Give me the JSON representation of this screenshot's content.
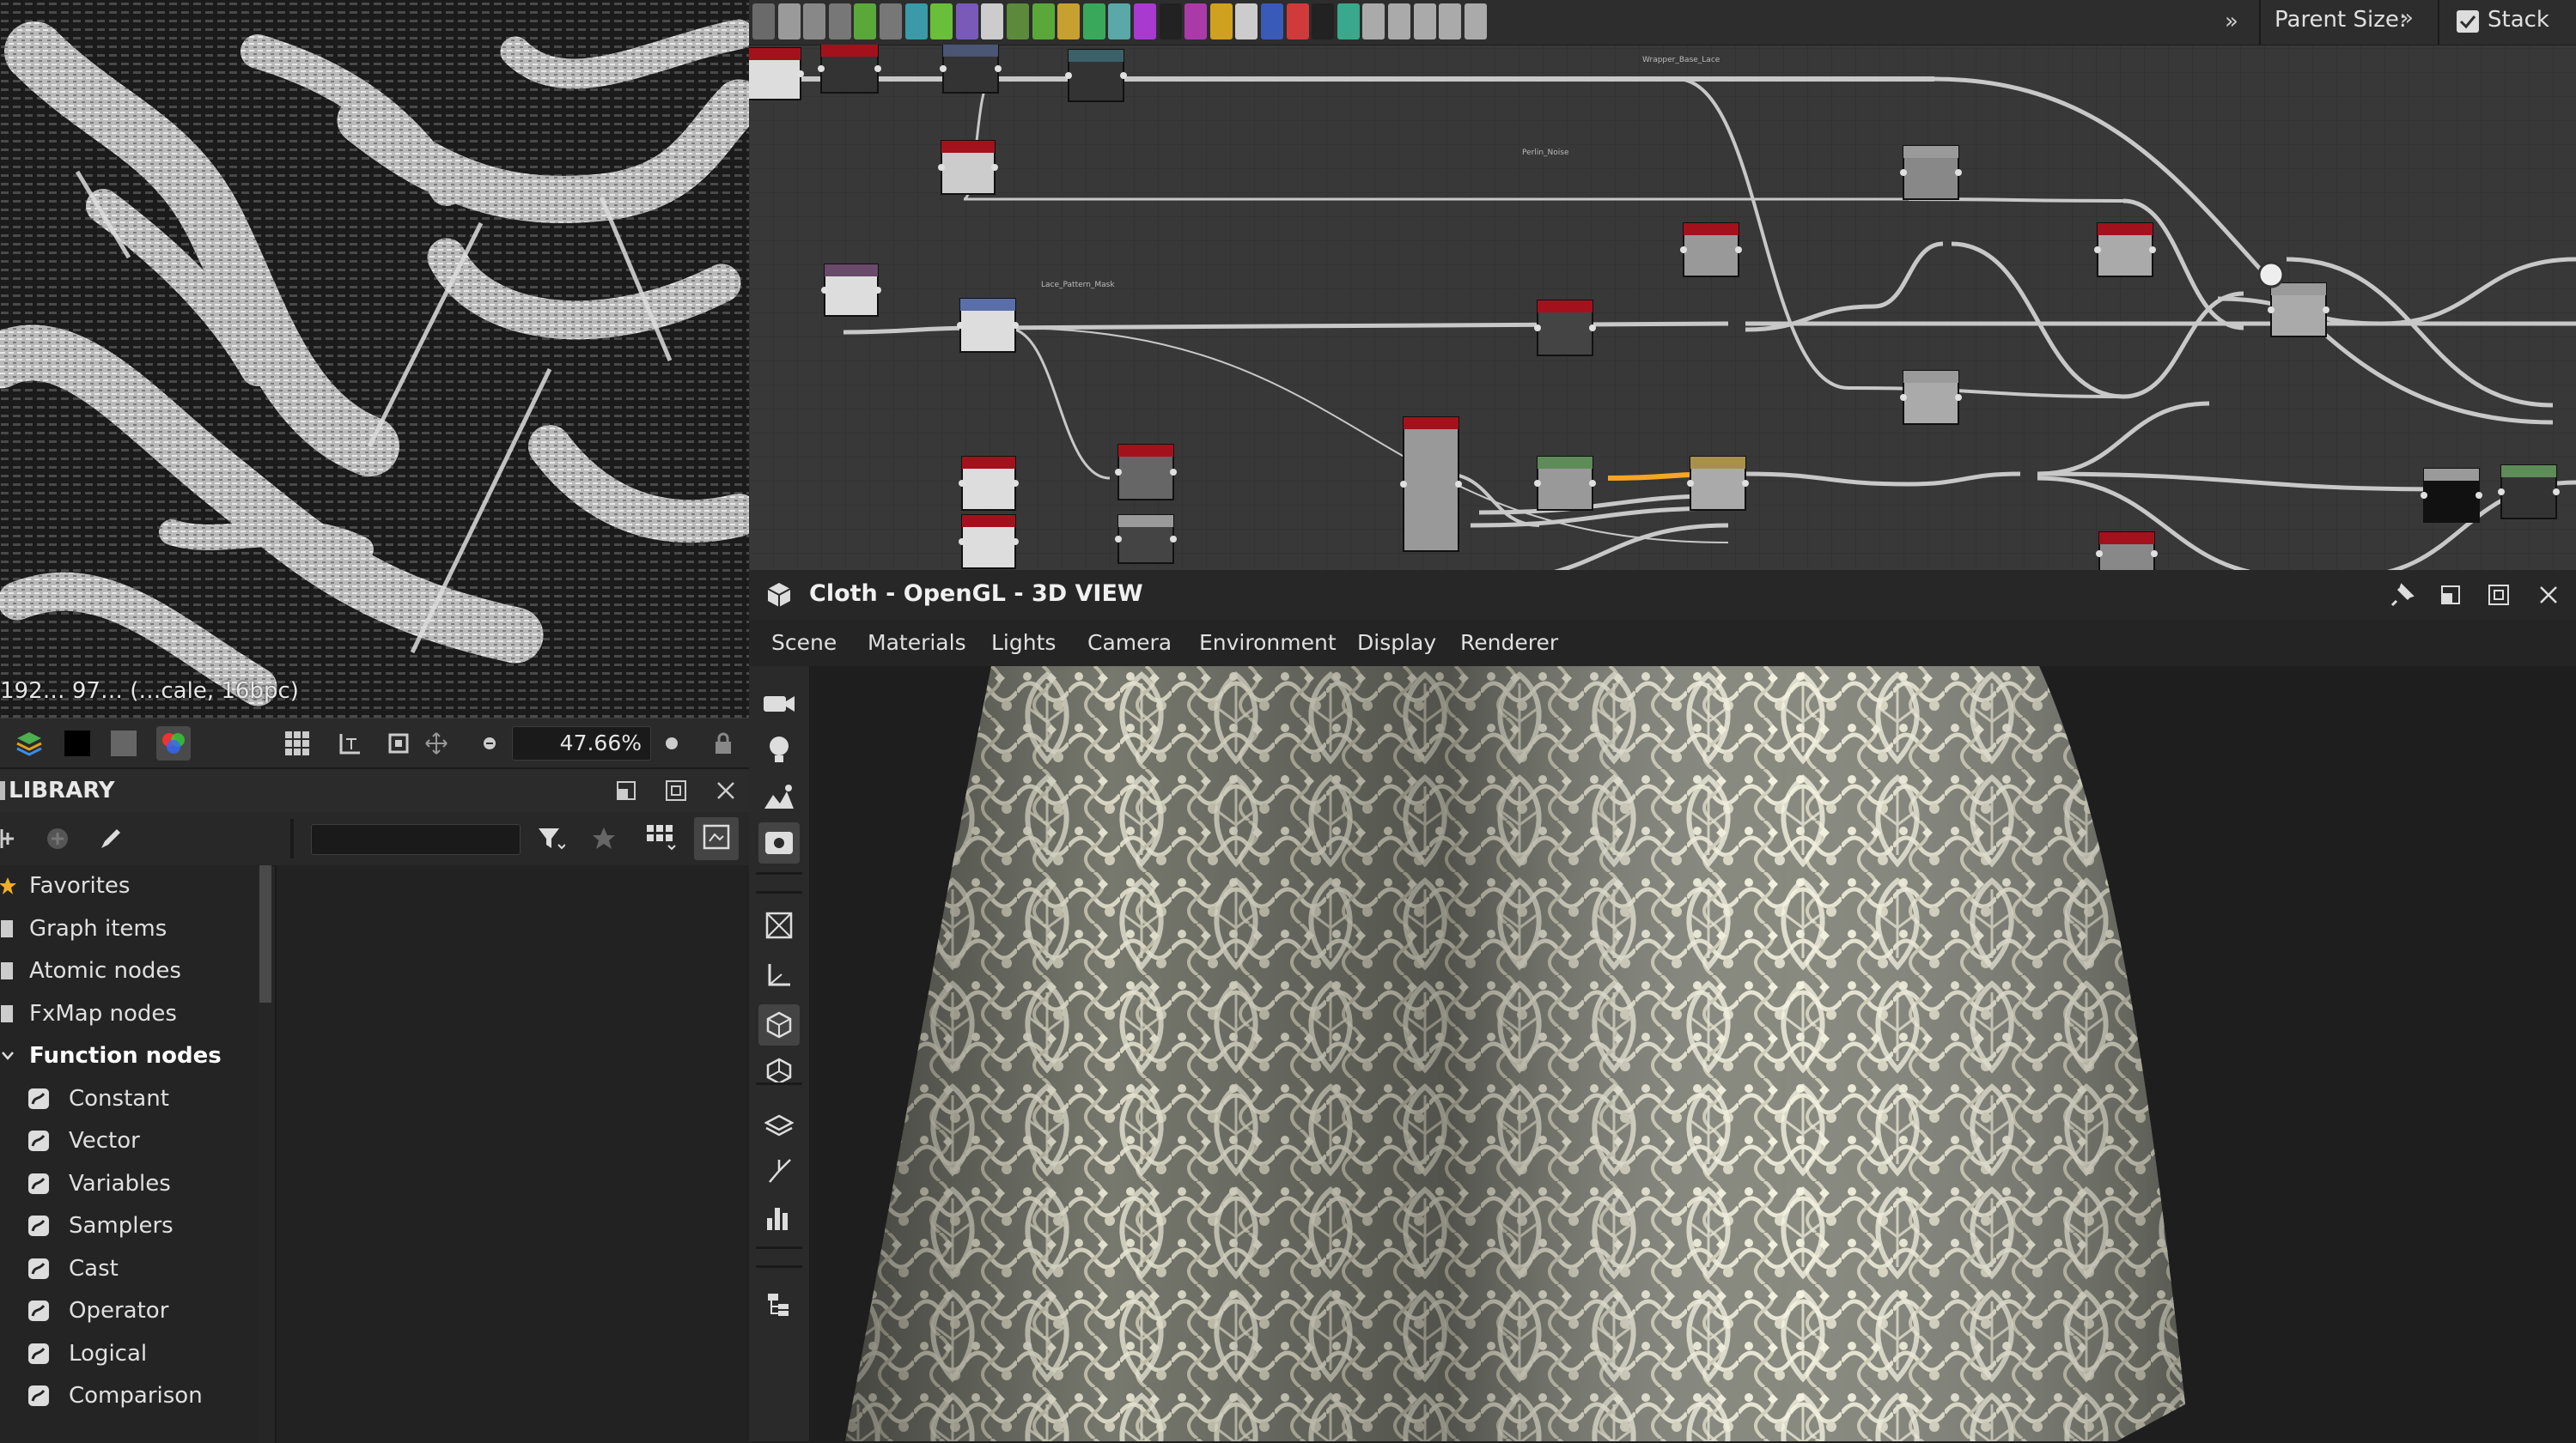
{
  "view2d": {
    "status": "192… 97… (…cale, 16bpc)",
    "zoom": "47.66%"
  },
  "library": {
    "title": "LIBRARY",
    "search": {
      "value": "",
      "placeholder": ""
    },
    "tree": [
      {
        "label": "Favorites",
        "icon": "star-icon"
      },
      {
        "label": "Graph items",
        "icon": "graph-items-icon"
      },
      {
        "label": "Atomic nodes",
        "icon": "atomic-nodes-icon"
      },
      {
        "label": "FxMap nodes",
        "icon": "fxmap-icon"
      },
      {
        "label": "Function nodes",
        "icon": "chevron-down-icon",
        "bold": true
      },
      {
        "label": "Constant",
        "icon": "function-icon",
        "child": true
      },
      {
        "label": "Vector",
        "icon": "function-icon",
        "child": true
      },
      {
        "label": "Variables",
        "icon": "function-icon",
        "child": true
      },
      {
        "label": "Samplers",
        "icon": "function-icon",
        "child": true
      },
      {
        "label": "Cast",
        "icon": "function-icon",
        "child": true
      },
      {
        "label": "Operator",
        "icon": "function-icon",
        "child": true
      },
      {
        "label": "Logical",
        "icon": "function-icon",
        "child": true
      },
      {
        "label": "Comparison",
        "icon": "function-icon",
        "child": true
      }
    ]
  },
  "graph": {
    "parent_size_label": "Parent Size:",
    "stack_label": "Stack",
    "node_labels": {
      "a": "Wrapper_Base_Lace",
      "b": "Perlin_Noise",
      "c": "Lace_Pattern_Mask"
    },
    "colors": {
      "red": "#a3121c",
      "navy": "#4b5574",
      "teal": "#3c6068",
      "purple": "#6a4a6a",
      "blue": "#5a6ea8",
      "green": "#5e8c58",
      "gold": "#a8904a",
      "grey": "#9a9a9a",
      "wire": "#c8c8c8",
      "wire_hl": "#f5a623"
    }
  },
  "view3d": {
    "title": "Cloth - OpenGL - 3D VIEW",
    "menu": [
      "Scene",
      "Materials",
      "Lights",
      "Camera",
      "Environment",
      "Display",
      "Renderer"
    ],
    "sidebar_icons": [
      "camera-icon",
      "light-bulb-icon",
      "environment-icon",
      "settings-icon",
      "wireframe-icon",
      "axis-icon",
      "cube-icon",
      "cube-outline-icon",
      "layers-icon",
      "uv-icon",
      "histogram-icon",
      "hierarchy-icon"
    ]
  }
}
